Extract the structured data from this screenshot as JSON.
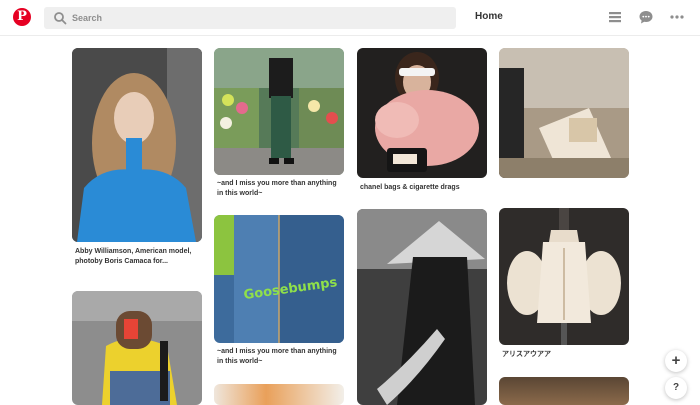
{
  "header": {
    "logo_text": "P",
    "search_placeholder": "Search",
    "home_label": "Home",
    "icons": [
      "pinterest-logo",
      "search-icon",
      "menu-icon",
      "chat-icon",
      "more-icon"
    ]
  },
  "pins": [
    {
      "caption": "Abby Williamson, American model, photoby Boris Camaca for..."
    },
    {
      "caption": "~and I miss you more than anything in this world~"
    },
    {
      "caption": "chanel bags & cigarette drags"
    },
    {
      "caption": ""
    },
    {
      "caption": "~and I miss you more than anything in this world~"
    },
    {
      "caption": "アリスアウアア"
    }
  ],
  "fab": {
    "add_label": "+",
    "help_label": "?"
  },
  "colors": {
    "brand": "#e60023",
    "search_bg": "#efefef"
  }
}
